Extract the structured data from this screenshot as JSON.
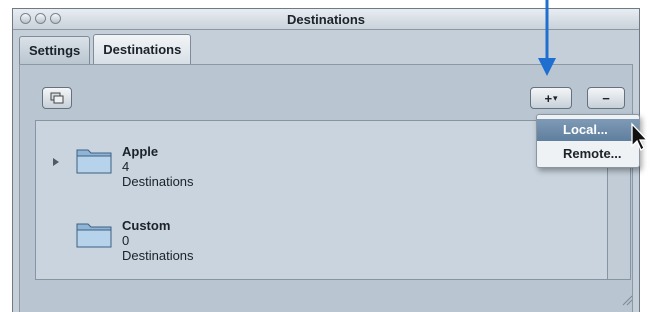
{
  "window": {
    "title": "Destinations"
  },
  "tabs": [
    {
      "label": "Settings",
      "active": false
    },
    {
      "label": "Destinations",
      "active": true
    }
  ],
  "toolbar": {
    "add_label": "+",
    "add_menu_indicator": "▾",
    "remove_label": "−"
  },
  "list": {
    "items": [
      {
        "name": "Apple",
        "count_text": "4 Destinations",
        "expandable": true
      },
      {
        "name": "Custom",
        "count_text": "0 Destinations",
        "expandable": false
      }
    ]
  },
  "add_menu": {
    "items": [
      {
        "label": "Local...",
        "highlighted": true
      },
      {
        "label": "Remote...",
        "highlighted": false
      }
    ]
  },
  "colors": {
    "callout_arrow": "#1f6fd0",
    "menu_highlight": "#6d8cab"
  }
}
